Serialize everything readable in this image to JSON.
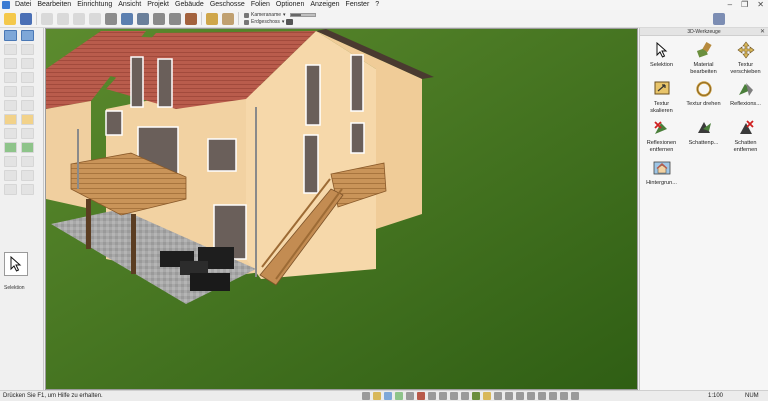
{
  "menubar": {
    "items": [
      "Datei",
      "Bearbeiten",
      "Einrichtung",
      "Ansicht",
      "Projekt",
      "Gebäude",
      "Geschosse",
      "Folien",
      "Optionen",
      "Anzeigen",
      "Fenster",
      "?"
    ],
    "window_controls": {
      "minimize": "–",
      "restore": "❐",
      "close": "✕"
    }
  },
  "toolbar": {
    "camera_combo_label": "Kameraname",
    "floor_combo_label": "Erdgeschoss",
    "combo_arrow": "▾",
    "slider_level": 0.45
  },
  "left_panel": {
    "selection_label": "Selektion"
  },
  "right_panel": {
    "title": "3D-Werkzeuge",
    "close": "✕",
    "tools": [
      {
        "label": "Selektion",
        "icon": "cursor-icon"
      },
      {
        "label": "Material bearbeiten",
        "icon": "brush-icon"
      },
      {
        "label": "Textur verschieben",
        "icon": "move-arrows-icon"
      },
      {
        "label": "Textur skalieren",
        "icon": "scale-icon"
      },
      {
        "label": "Textur drehen",
        "icon": "rotate-icon"
      },
      {
        "label": "Reflexions...",
        "icon": "reflection-icon"
      },
      {
        "label": "Reflexionen entfernen",
        "icon": "remove-reflection-icon"
      },
      {
        "label": "Schattenp...",
        "icon": "shadow-icon"
      },
      {
        "label": "Schatten entfernen",
        "icon": "remove-shadow-icon"
      },
      {
        "label": "Hintergrun...",
        "icon": "background-icon"
      }
    ]
  },
  "statusbar": {
    "help_text": "Drücken Sie F1, um Hilfe zu erhalten.",
    "scale": "1:100",
    "num": "NUM"
  },
  "colors": {
    "grass": "#3b6d1a",
    "wall": "#f1d2a4",
    "roof": "#b85a4a",
    "wood": "#c8955a",
    "terrace": "#a9a9a9"
  }
}
